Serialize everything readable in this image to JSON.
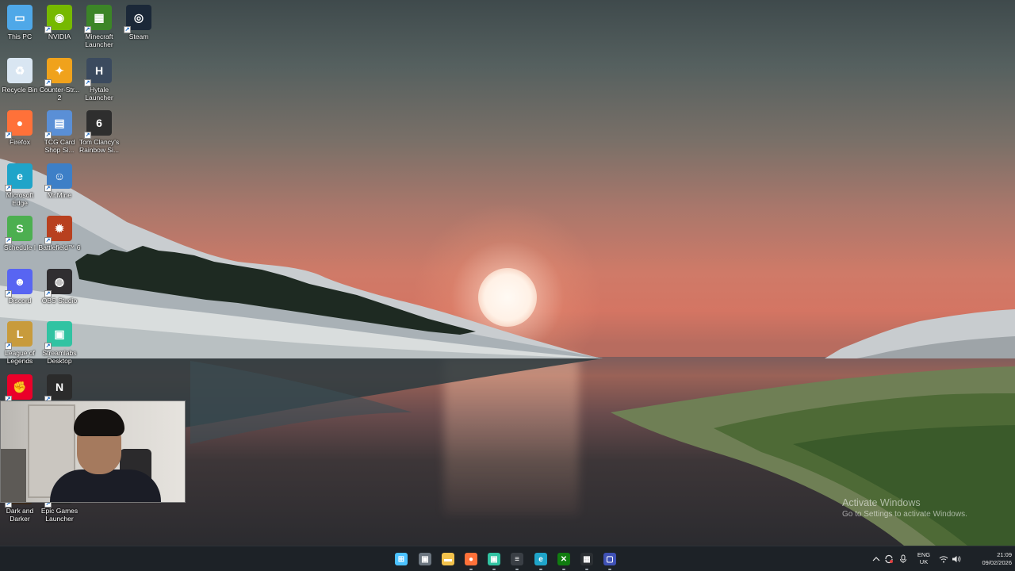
{
  "desktop": {
    "icons": [
      {
        "label": "This PC",
        "icon": "this-pc-icon",
        "color": "#4fa8e8"
      },
      {
        "label": "NVIDIA",
        "icon": "nvidia-icon",
        "color": "#76b900"
      },
      {
        "label": "Minecraft Launcher",
        "icon": "minecraft-launcher-icon",
        "color": "#3c8527"
      },
      {
        "label": "Steam",
        "icon": "steam-icon",
        "color": "#1b2838"
      },
      {
        "label": "Recycle Bin",
        "icon": "recycle-bin-icon",
        "color": "#d9e6f2"
      },
      {
        "label": "Counter-Str... 2",
        "icon": "counter-strike-icon",
        "color": "#f0a21c"
      },
      {
        "label": "Hytale Launcher",
        "icon": "hytale-launcher-icon",
        "color": "#3b4a5e"
      },
      {
        "label": "Firefox",
        "icon": "firefox-icon",
        "color": "#ff7139"
      },
      {
        "label": "TCG Card Shop Si...",
        "icon": "tcg-card-shop-icon",
        "color": "#5a8fd6"
      },
      {
        "label": "Tom Clancy's Rainbow Si...",
        "icon": "rainbow-six-icon",
        "color": "#2e2e2e"
      },
      {
        "label": "Microsoft Edge",
        "icon": "edge-icon",
        "color": "#1fa4c9"
      },
      {
        "label": "Mr.Mine",
        "icon": "mr-mine-icon",
        "color": "#3d7fc7"
      },
      {
        "label": "Schedule I",
        "icon": "schedule-i-icon",
        "color": "#4caf50"
      },
      {
        "label": "Battlefield™ 6",
        "icon": "battlefield-icon",
        "color": "#b8401f"
      },
      {
        "label": "Discord",
        "icon": "discord-icon",
        "color": "#5865f2"
      },
      {
        "label": "OBS Studio",
        "icon": "obs-studio-icon",
        "color": "#302e31"
      },
      {
        "label": "League of Legends",
        "icon": "league-of-legends-icon",
        "color": "#c89b3c"
      },
      {
        "label": "Streamlabs Desktop",
        "icon": "streamlabs-icon",
        "color": "#31c3a2"
      },
      {
        "label": "",
        "icon": "riot-client-icon",
        "color": "#eb0029"
      },
      {
        "label": "",
        "icon": "nicehash-icon",
        "color": "#2b2b2b"
      },
      {
        "label": "Dark and Darker",
        "icon": "dark-and-darker-icon",
        "color": "#3a2a1c"
      },
      {
        "label": "Epic Games Launcher",
        "icon": "epic-games-icon",
        "color": "#2a2a2a"
      }
    ]
  },
  "watermark": {
    "title": "Activate Windows",
    "subtitle": "Go to Settings to activate Windows."
  },
  "taskbar": {
    "apps": [
      {
        "name": "start",
        "icon": "windows-start-icon",
        "color": "#4cc2ff",
        "glyph": "⊞"
      },
      {
        "name": "task-view",
        "icon": "task-view-icon",
        "color": "#6c7680",
        "glyph": "▣"
      },
      {
        "name": "file-explorer",
        "icon": "file-explorer-icon",
        "color": "#f2c24c",
        "glyph": "▬"
      },
      {
        "name": "firefox",
        "icon": "firefox-icon",
        "color": "#ff7139",
        "glyph": "●"
      },
      {
        "name": "streamlabs",
        "icon": "streamlabs-icon",
        "color": "#31c3a2",
        "glyph": "▣"
      },
      {
        "name": "clapper",
        "icon": "clapperboard-icon",
        "color": "#3a3f45",
        "glyph": "≡"
      },
      {
        "name": "edge",
        "icon": "edge-icon",
        "color": "#1fa4c9",
        "glyph": "e"
      },
      {
        "name": "xbox",
        "icon": "xbox-icon",
        "color": "#107c10",
        "glyph": "✕"
      },
      {
        "name": "terminal",
        "icon": "terminal-icon",
        "color": "#2b2f33",
        "glyph": "▦"
      },
      {
        "name": "obs",
        "icon": "obs-icon",
        "color": "#3f51b5",
        "glyph": "▢"
      }
    ],
    "tray": {
      "lang_line1": "ENG",
      "lang_line2": "UK",
      "time": "21:09",
      "date": "09/02/2026"
    }
  }
}
